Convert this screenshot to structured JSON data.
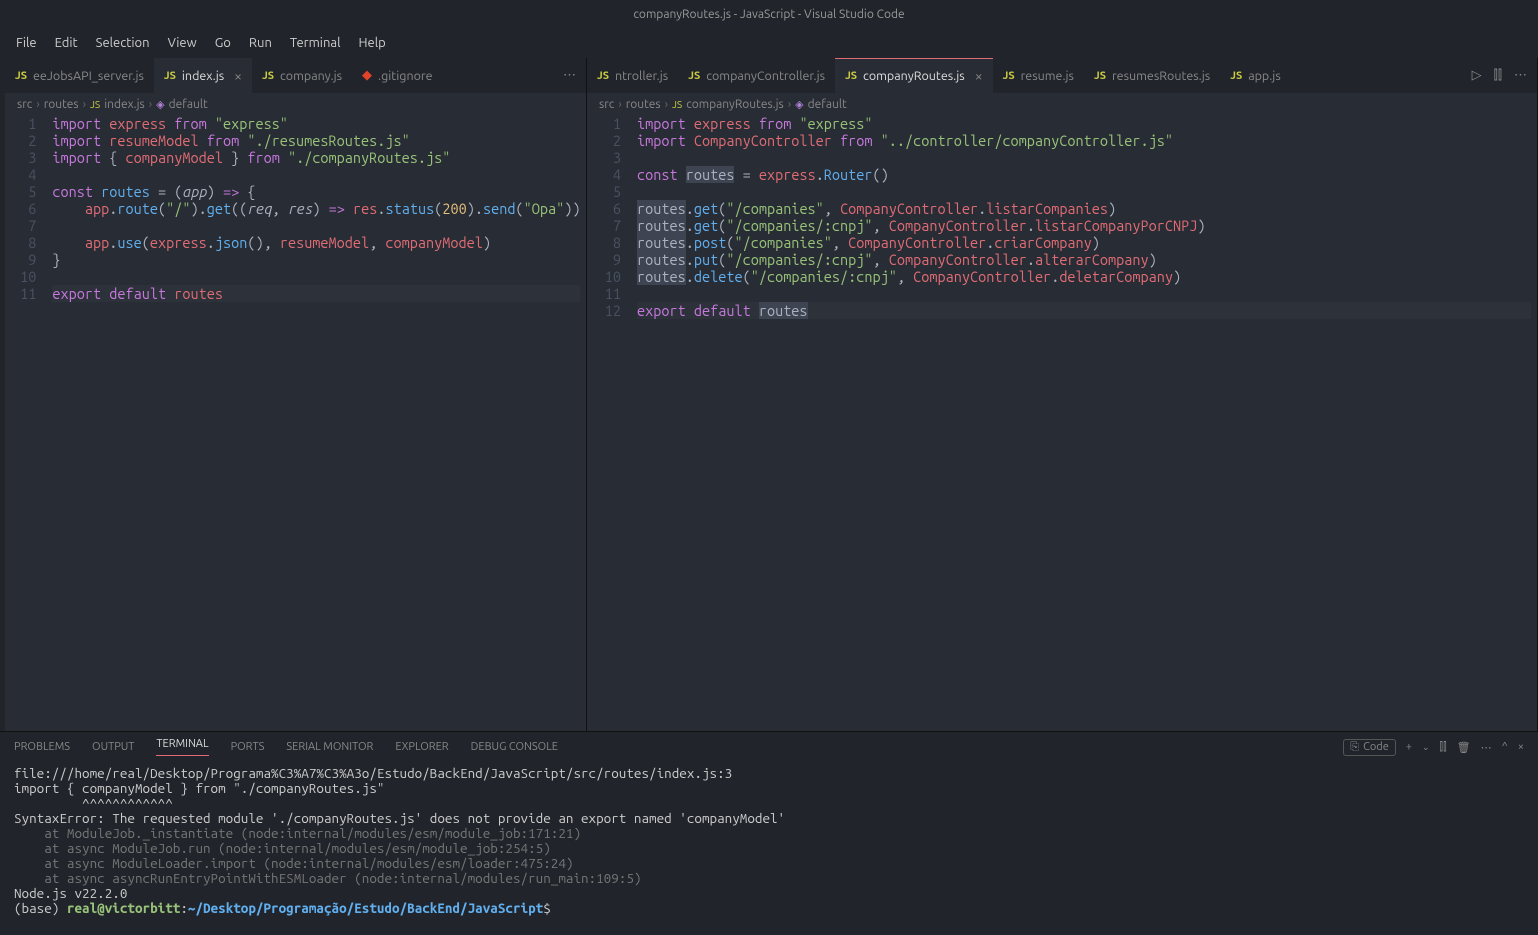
{
  "window": {
    "title": "companyRoutes.js - JavaScript - Visual Studio Code"
  },
  "menu": [
    "File",
    "Edit",
    "Selection",
    "View",
    "Go",
    "Run",
    "Terminal",
    "Help"
  ],
  "left": {
    "tabs": [
      {
        "label": "eeJobsAPI_server.js",
        "type": "js",
        "active": false
      },
      {
        "label": "index.js",
        "type": "js",
        "active": true,
        "close": "×"
      },
      {
        "label": "company.js",
        "type": "js",
        "active": false
      },
      {
        "label": ".gitignore",
        "type": "git",
        "active": false
      }
    ],
    "actions_ellipsis": "⋯",
    "breadcrumb": [
      "src",
      "routes",
      "index.js",
      "default"
    ],
    "lines": [
      "1",
      "2",
      "3",
      "4",
      "5",
      "6",
      "7",
      "8",
      "9",
      "10",
      "11"
    ],
    "code": [
      {
        "t": [
          [
            "kw",
            "import"
          ],
          [
            "op",
            " "
          ],
          [
            "var",
            "express"
          ],
          [
            "op",
            " "
          ],
          [
            "kw",
            "from"
          ],
          [
            "op",
            " "
          ],
          [
            "str",
            "\"express\""
          ]
        ]
      },
      {
        "t": [
          [
            "kw",
            "import"
          ],
          [
            "op",
            " "
          ],
          [
            "var",
            "resumeModel"
          ],
          [
            "op",
            " "
          ],
          [
            "kw",
            "from"
          ],
          [
            "op",
            " "
          ],
          [
            "str",
            "\"./resumesRoutes.js\""
          ]
        ]
      },
      {
        "t": [
          [
            "kw",
            "import"
          ],
          [
            "op",
            " { "
          ],
          [
            "var",
            "companyModel"
          ],
          [
            "op",
            " } "
          ],
          [
            "kw",
            "from"
          ],
          [
            "op",
            " "
          ],
          [
            "str",
            "\"./companyRoutes.js\""
          ]
        ]
      },
      {
        "t": []
      },
      {
        "t": [
          [
            "kw",
            "const"
          ],
          [
            "op",
            " "
          ],
          [
            "fn",
            "routes"
          ],
          [
            "op",
            " = ("
          ],
          [
            "pr",
            "app"
          ],
          [
            "op",
            ") "
          ],
          [
            "kw",
            "=>"
          ],
          [
            "op",
            " {"
          ]
        ]
      },
      {
        "t": [
          [
            "op",
            "    "
          ],
          [
            "var",
            "app"
          ],
          [
            "op",
            "."
          ],
          [
            "fn",
            "route"
          ],
          [
            "op",
            "("
          ],
          [
            "str",
            "\"/\""
          ],
          [
            "op",
            ")."
          ],
          [
            "fn",
            "get"
          ],
          [
            "op",
            "(("
          ],
          [
            "pr",
            "req"
          ],
          [
            "op",
            ", "
          ],
          [
            "pr",
            "res"
          ],
          [
            "op",
            ") "
          ],
          [
            "kw",
            "=>"
          ],
          [
            "op",
            " "
          ],
          [
            "var",
            "res"
          ],
          [
            "op",
            "."
          ],
          [
            "fn",
            "status"
          ],
          [
            "op",
            "("
          ],
          [
            "cn",
            "200"
          ],
          [
            "op",
            ")."
          ],
          [
            "fn",
            "send"
          ],
          [
            "op",
            "("
          ],
          [
            "str",
            "\"Opa\""
          ],
          [
            "op",
            "))"
          ]
        ]
      },
      {
        "t": []
      },
      {
        "t": [
          [
            "op",
            "    "
          ],
          [
            "var",
            "app"
          ],
          [
            "op",
            "."
          ],
          [
            "fn",
            "use"
          ],
          [
            "op",
            "("
          ],
          [
            "var",
            "express"
          ],
          [
            "op",
            "."
          ],
          [
            "fn",
            "json"
          ],
          [
            "op",
            "(), "
          ],
          [
            "var",
            "resumeModel"
          ],
          [
            "op",
            ", "
          ],
          [
            "var",
            "companyModel"
          ],
          [
            "op",
            ")"
          ]
        ]
      },
      {
        "t": [
          [
            "op",
            "}"
          ]
        ]
      },
      {
        "t": []
      },
      {
        "hl": true,
        "t": [
          [
            "kw",
            "export"
          ],
          [
            "op",
            " "
          ],
          [
            "kw",
            "default"
          ],
          [
            "op",
            " "
          ],
          [
            "var",
            "routes"
          ]
        ]
      }
    ]
  },
  "right": {
    "tabs": [
      {
        "label": "ntroller.js",
        "type": "js",
        "active": false
      },
      {
        "label": "companyController.js",
        "type": "js",
        "active": false
      },
      {
        "label": "companyRoutes.js",
        "type": "js",
        "active": true,
        "close": "×",
        "pink": true
      },
      {
        "label": "resume.js",
        "type": "js",
        "active": false
      },
      {
        "label": "resumesRoutes.js",
        "type": "js",
        "active": false
      },
      {
        "label": "app.js",
        "type": "js",
        "active": false
      }
    ],
    "actions": [
      "▷",
      "⫿⫿",
      "⋯"
    ],
    "breadcrumb": [
      "src",
      "routes",
      "companyRoutes.js",
      "default"
    ],
    "lines": [
      "1",
      "2",
      "3",
      "4",
      "5",
      "6",
      "7",
      "8",
      "9",
      "10",
      "11",
      "12"
    ],
    "code": [
      {
        "t": [
          [
            "kw",
            "import"
          ],
          [
            "op",
            " "
          ],
          [
            "var",
            "express"
          ],
          [
            "op",
            " "
          ],
          [
            "kw",
            "from"
          ],
          [
            "op",
            " "
          ],
          [
            "str",
            "\"express\""
          ]
        ]
      },
      {
        "t": [
          [
            "kw",
            "import"
          ],
          [
            "op",
            " "
          ],
          [
            "var",
            "CompanyController"
          ],
          [
            "op",
            " "
          ],
          [
            "kw",
            "from"
          ],
          [
            "op",
            " "
          ],
          [
            "str",
            "\"../controller/companyController.js\""
          ]
        ]
      },
      {
        "t": []
      },
      {
        "t": [
          [
            "kw",
            "const"
          ],
          [
            "op",
            " "
          ],
          [
            "sel",
            "routes"
          ],
          [
            "op",
            " = "
          ],
          [
            "var",
            "express"
          ],
          [
            "op",
            "."
          ],
          [
            "fn",
            "Router"
          ],
          [
            "op",
            "()"
          ]
        ]
      },
      {
        "t": []
      },
      {
        "t": [
          [
            "sel",
            "routes"
          ],
          [
            "op",
            "."
          ],
          [
            "fn",
            "get"
          ],
          [
            "op",
            "("
          ],
          [
            "str",
            "\"/companies\""
          ],
          [
            "op",
            ", "
          ],
          [
            "var",
            "CompanyController"
          ],
          [
            "op",
            "."
          ],
          [
            "var",
            "listarCompanies"
          ],
          [
            "op",
            ")"
          ]
        ]
      },
      {
        "t": [
          [
            "sel",
            "routes"
          ],
          [
            "op",
            "."
          ],
          [
            "fn",
            "get"
          ],
          [
            "op",
            "("
          ],
          [
            "str",
            "\"/companies/:cnpj\""
          ],
          [
            "op",
            ", "
          ],
          [
            "var",
            "CompanyController"
          ],
          [
            "op",
            "."
          ],
          [
            "var",
            "listarCompanyPorCNPJ"
          ],
          [
            "op",
            ")"
          ]
        ]
      },
      {
        "t": [
          [
            "sel",
            "routes"
          ],
          [
            "op",
            "."
          ],
          [
            "fn",
            "post"
          ],
          [
            "op",
            "("
          ],
          [
            "str",
            "\"/companies\""
          ],
          [
            "op",
            ", "
          ],
          [
            "var",
            "CompanyController"
          ],
          [
            "op",
            "."
          ],
          [
            "var",
            "criarCompany"
          ],
          [
            "op",
            ")"
          ]
        ]
      },
      {
        "t": [
          [
            "sel",
            "routes"
          ],
          [
            "op",
            "."
          ],
          [
            "fn",
            "put"
          ],
          [
            "op",
            "("
          ],
          [
            "str",
            "\"/companies/:cnpj\""
          ],
          [
            "op",
            ", "
          ],
          [
            "var",
            "CompanyController"
          ],
          [
            "op",
            "."
          ],
          [
            "var",
            "alterarCompany"
          ],
          [
            "op",
            ")"
          ]
        ]
      },
      {
        "t": [
          [
            "sel",
            "routes"
          ],
          [
            "op",
            "."
          ],
          [
            "fn",
            "delete"
          ],
          [
            "op",
            "("
          ],
          [
            "str",
            "\"/companies/:cnpj\""
          ],
          [
            "op",
            ", "
          ],
          [
            "var",
            "CompanyController"
          ],
          [
            "op",
            "."
          ],
          [
            "var",
            "deletarCompany"
          ],
          [
            "op",
            ")"
          ]
        ]
      },
      {
        "t": []
      },
      {
        "hl": true,
        "t": [
          [
            "kw",
            "export"
          ],
          [
            "op",
            " "
          ],
          [
            "kw",
            "default"
          ],
          [
            "op",
            " "
          ],
          [
            "sel",
            "routes"
          ]
        ]
      }
    ]
  },
  "panel": {
    "tabs": [
      "PROBLEMS",
      "OUTPUT",
      "TERMINAL",
      "PORTS",
      "SERIAL MONITOR",
      "EXPLORER",
      "DEBUG CONSOLE"
    ],
    "active": "TERMINAL",
    "badge": "Code",
    "terminal": {
      "lines": [
        "file:///home/real/Desktop/Programa%C3%A7%C3%A3o/Estudo/BackEnd/JavaScript/src/routes/index.js:3",
        "import { companyModel } from \"./companyRoutes.js\"",
        "         ^^^^^^^^^^^^",
        "SyntaxError: The requested module './companyRoutes.js' does not provide an export named 'companyModel'",
        "    at ModuleJob._instantiate (node:internal/modules/esm/module_job:171:21)",
        "    at async ModuleJob.run (node:internal/modules/esm/module_job:254:5)",
        "    at async ModuleLoader.import (node:internal/modules/esm/loader:475:24)",
        "    at async asyncRunEntryPointWithESMLoader (node:internal/modules/run_main:109:5)",
        "",
        "Node.js v22.2.0"
      ],
      "prompt_prefix": "(base) ",
      "prompt_user": "real@victorbitt",
      "prompt_sep": ":",
      "prompt_path": "~/Desktop/Programação/Estudo/BackEnd/JavaScript",
      "prompt_end": "$"
    }
  }
}
